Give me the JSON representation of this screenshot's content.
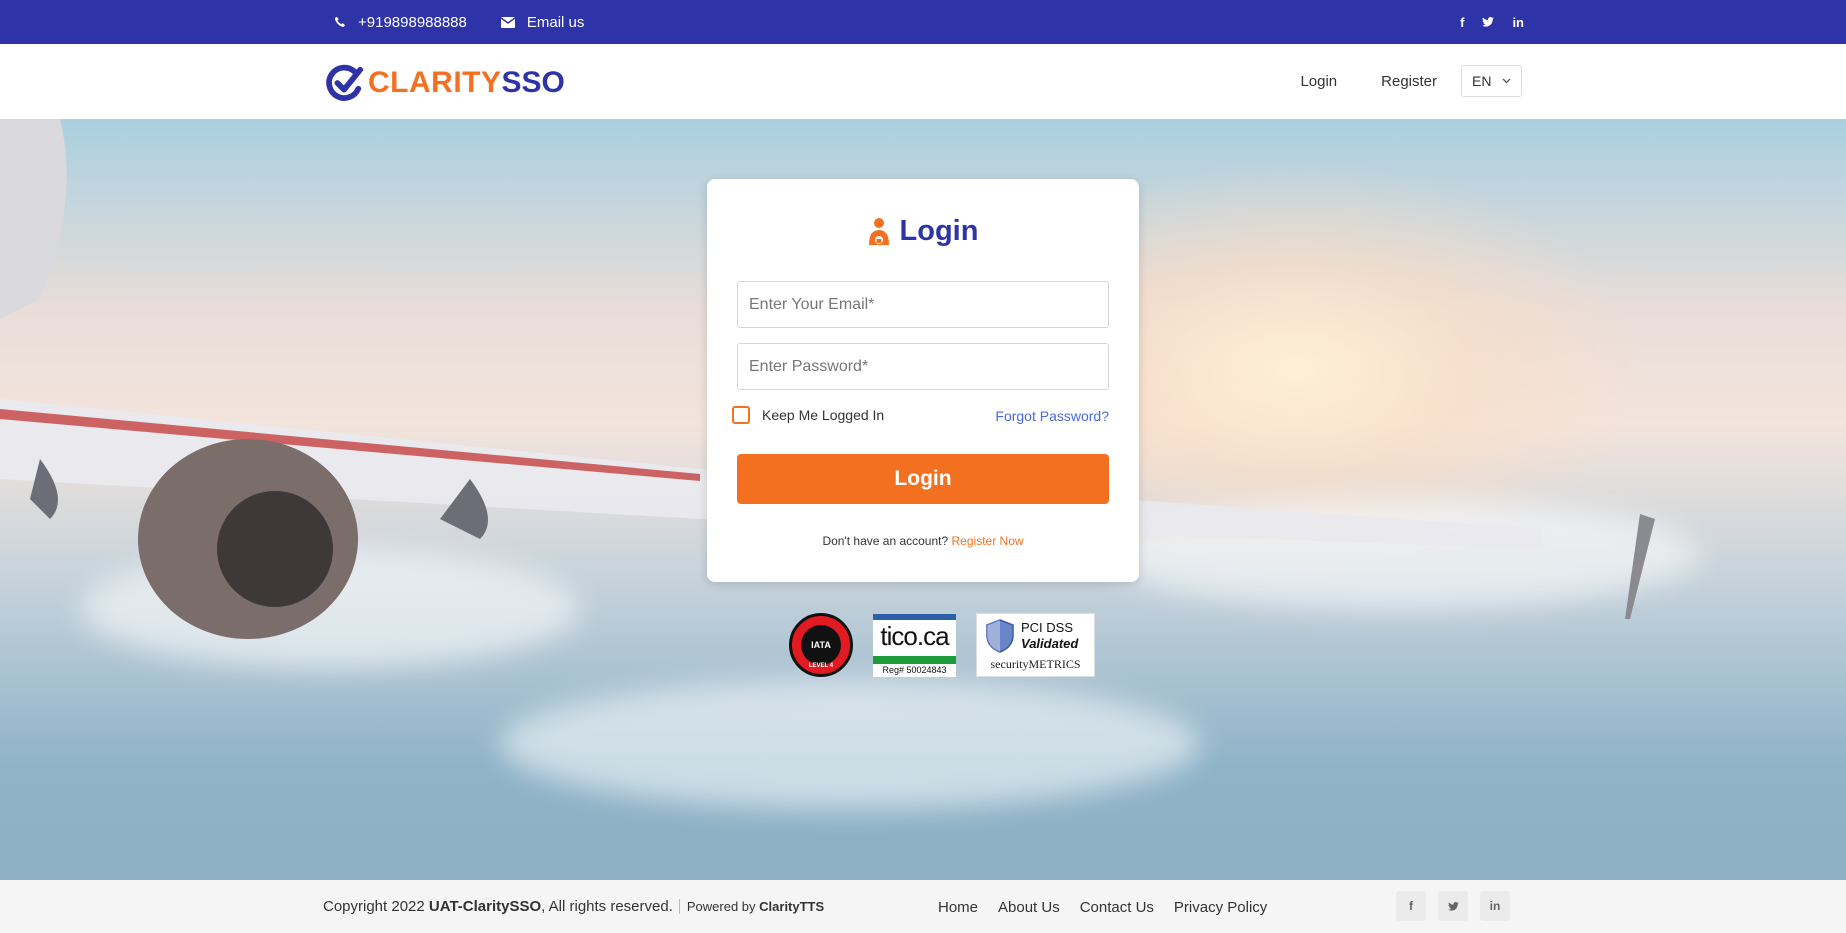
{
  "topbar": {
    "phone": "+919898988888",
    "email_label": "Email us",
    "social": [
      "facebook-icon",
      "twitter-icon",
      "linkedin-icon"
    ],
    "bg_color": "#2e33a8"
  },
  "header": {
    "logo_part1": "CLARITY",
    "logo_part2": "SSO",
    "nav": {
      "login": "Login",
      "register": "Register"
    },
    "language": "EN"
  },
  "login_card": {
    "title": "Login",
    "email_placeholder": "Enter Your Email*",
    "password_placeholder": "Enter Password*",
    "remember_label": "Keep Me Logged In",
    "forgot_label": "Forgot Password?",
    "submit_label": "Login",
    "no_account_text": "Don't have an account?",
    "register_link": "Register Now",
    "accent_color": "#f37021"
  },
  "badges": {
    "iata_top": "IDC CERTIFIED",
    "iata_center": "IATA",
    "iata_level": "LEVEL 4",
    "tico_name": "tico.ca",
    "tico_reg": "Reg# 50024843",
    "pci_line1": "PCI DSS",
    "pci_line2": "Validated",
    "pci_line3": "securityMETRICS"
  },
  "footer": {
    "copyright_prefix": "Copyright 2022",
    "site_name": "UAT-ClaritySSO",
    "rights": ", All rights reserved.",
    "powered_prefix": "Powered by",
    "powered_name": "ClarityTTS",
    "links": [
      "Home",
      "About Us",
      "Contact Us",
      "Privacy Policy"
    ]
  }
}
